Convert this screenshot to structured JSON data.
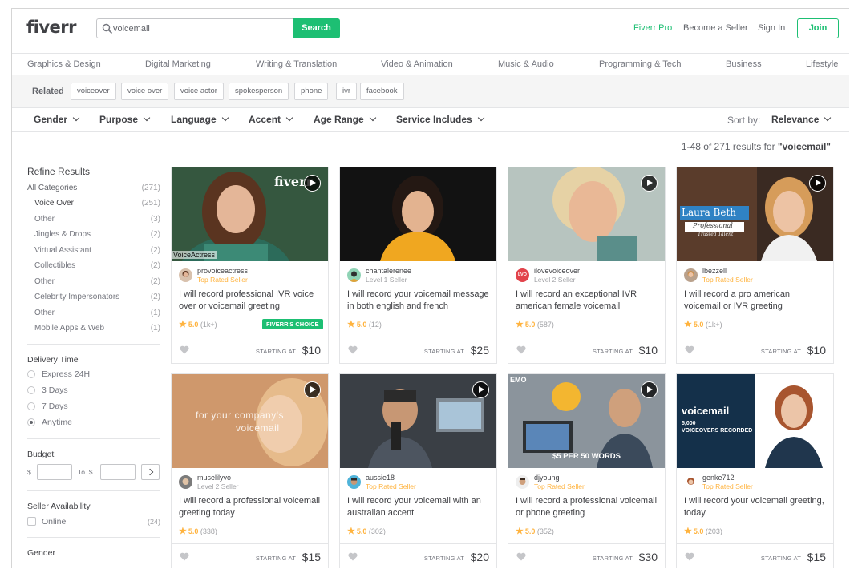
{
  "header": {
    "logo": "fiverr",
    "search_value": "voicemail",
    "search_button": "Search",
    "fiverr_pro": "Fiverr Pro",
    "become_seller": "Become a Seller",
    "sign_in": "Sign In",
    "join": "Join",
    "accent_color": "#1dbf73"
  },
  "categories": [
    "Graphics & Design",
    "Digital Marketing",
    "Writing & Translation",
    "Video & Animation",
    "Music & Audio",
    "Programming & Tech",
    "Business",
    "Lifestyle"
  ],
  "related": {
    "label": "Related",
    "tags": [
      "voiceover",
      "voice over",
      "voice actor",
      "spokesperson",
      "phone",
      "ivr",
      "facebook"
    ]
  },
  "filters": {
    "items": [
      "Gender",
      "Purpose",
      "Language",
      "Accent",
      "Age Range",
      "Service Includes"
    ],
    "sort_label": "Sort by:",
    "sort_value": "Relevance"
  },
  "results": {
    "prefix": "1-48 of 271 results for ",
    "query": "\"voicemail\""
  },
  "sidebar": {
    "title": "Refine Results",
    "categories": [
      {
        "label": "All Categories",
        "count": "(271)"
      },
      {
        "label": "Voice Over",
        "count": "(251)"
      },
      {
        "label": "Other",
        "count": "(3)"
      },
      {
        "label": "Jingles & Drops",
        "count": "(2)"
      },
      {
        "label": "Virtual Assistant",
        "count": "(2)"
      },
      {
        "label": "Collectibles",
        "count": "(2)"
      },
      {
        "label": "Other",
        "count": "(2)"
      },
      {
        "label": "Celebrity Impersonators",
        "count": "(2)"
      },
      {
        "label": "Other",
        "count": "(1)"
      },
      {
        "label": "Mobile Apps & Web",
        "count": "(1)"
      }
    ],
    "delivery_title": "Delivery Time",
    "delivery_options": [
      "Express 24H",
      "3 Days",
      "7 Days",
      "Anytime"
    ],
    "delivery_selected": "Anytime",
    "budget_title": "Budget",
    "budget_from": "$",
    "budget_to": "To  $",
    "availability_title": "Seller Availability",
    "online_label": "Online",
    "online_count": "(24)",
    "gender_title": "Gender"
  },
  "gigs": [
    {
      "seller": "provoiceactress",
      "level": "Top Rated Seller",
      "title": "I will record professional IVR voice over or voicemail greeting",
      "rating": "5.0",
      "reviews": "(1k+)",
      "badge": "FIVERR'S CHOICE",
      "starting": "STARTING AT",
      "price": "$10",
      "thumb_text": "fiverr",
      "thumb_text2": "VoiceActress"
    },
    {
      "seller": "chantalerenee",
      "level": "Level 1 Seller",
      "title": "I will record your voicemail message in both english and french",
      "rating": "5.0",
      "reviews": "(12)",
      "starting": "STARTING AT",
      "price": "$25"
    },
    {
      "seller": "ilovevoiceover",
      "level": "Level 2 Seller",
      "title": "I will record an exceptional IVR american female voicemail",
      "rating": "5.0",
      "reviews": "(587)",
      "starting": "STARTING AT",
      "price": "$10",
      "avatar_text": "LVO"
    },
    {
      "seller": "lbezzell",
      "level": "Top Rated Seller",
      "title": "I will record a pro american voicemail or IVR greeting",
      "rating": "5.0",
      "reviews": "(1k+)",
      "starting": "STARTING AT",
      "price": "$10",
      "thumb_text": "Laura Beth",
      "thumb_text2": "Professional",
      "thumb_text3": "Trusted Talent"
    },
    {
      "seller": "muselilyvo",
      "level": "Level 2 Seller",
      "title": "I will record a professional voicemail greeting today",
      "rating": "5.0",
      "reviews": "(338)",
      "starting": "STARTING AT",
      "price": "$15",
      "thumb_text": "for your company's",
      "thumb_text2": "voicemail"
    },
    {
      "seller": "aussie18",
      "level": "Top Rated Seller",
      "title": "I will record your voicemail with an australian accent",
      "rating": "5.0",
      "reviews": "(302)",
      "starting": "STARTING AT",
      "price": "$20"
    },
    {
      "seller": "djyoung",
      "level": "Top Rated Seller",
      "title": "I will record a professional voicemail or phone greeting",
      "rating": "5.0",
      "reviews": "(352)",
      "starting": "STARTING AT",
      "price": "$30",
      "thumb_text": "$5 PER 50 WORDS",
      "thumb_text2": "EMO"
    },
    {
      "seller": "genke712",
      "level": "Top Rated Seller",
      "title": "I will record your voicemail greeting, today",
      "rating": "5.0",
      "reviews": "(203)",
      "starting": "STARTING AT",
      "price": "$15",
      "thumb_text": "voicemail",
      "thumb_text2": "5,000",
      "thumb_text3": "VOICEOVERS RECORDED"
    }
  ]
}
